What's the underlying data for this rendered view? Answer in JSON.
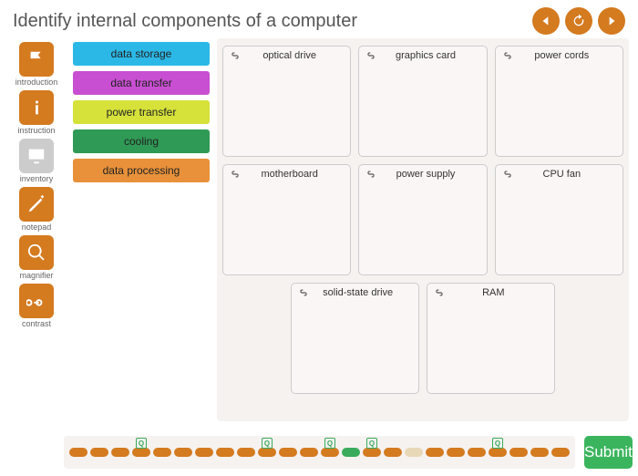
{
  "title": "Identify internal components of a computer",
  "sidebar": [
    {
      "label": "introduction",
      "icon": "flag",
      "style": "orange"
    },
    {
      "label": "instruction",
      "icon": "info",
      "style": "orange"
    },
    {
      "label": "inventory",
      "icon": "monitor",
      "style": "grey"
    },
    {
      "label": "notepad",
      "icon": "pencil",
      "style": "orange"
    },
    {
      "label": "magnifier",
      "icon": "magnify",
      "style": "orange"
    },
    {
      "label": "contrast",
      "icon": "glasses",
      "style": "orange"
    }
  ],
  "categories": [
    {
      "label": "data storage",
      "color": "#2bb8e6"
    },
    {
      "label": "data transfer",
      "color": "#c84fd1"
    },
    {
      "label": "power transfer",
      "color": "#d6e23a"
    },
    {
      "label": "cooling",
      "color": "#2f9a55"
    },
    {
      "label": "data processing",
      "color": "#e8913a"
    }
  ],
  "cards_row1": [
    "optical drive",
    "graphics card",
    "power cords"
  ],
  "cards_row2": [
    "motherboard",
    "power supply",
    "CPU fan"
  ],
  "cards_row3": [
    "solid-state drive",
    "RAM"
  ],
  "submit_label": "Submit",
  "progress": {
    "total_pips": 24,
    "green_index": 13,
    "beige_index": 16,
    "q_markers": [
      3,
      9,
      12,
      14,
      20
    ]
  }
}
